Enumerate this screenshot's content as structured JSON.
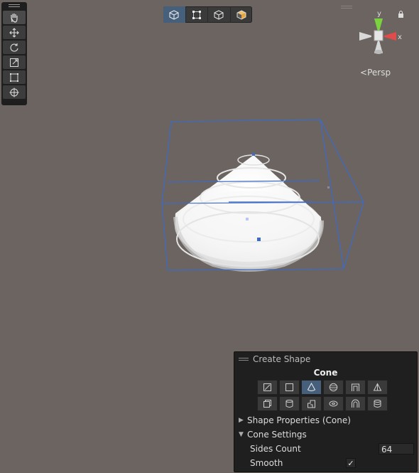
{
  "toolbar": {
    "tools": [
      {
        "icon": "hand-icon"
      },
      {
        "icon": "move-icon"
      },
      {
        "icon": "rotate-icon"
      },
      {
        "icon": "scale-icon"
      },
      {
        "icon": "rect-tool-icon"
      },
      {
        "icon": "transform-icon"
      }
    ]
  },
  "view_modes": [
    {
      "icon": "object-mode-icon",
      "active": true
    },
    {
      "icon": "vertex-mode-icon"
    },
    {
      "icon": "edge-mode-icon"
    },
    {
      "icon": "face-mode-icon"
    }
  ],
  "gizmo": {
    "y_label": "y",
    "x_label": "x",
    "projection": "Persp"
  },
  "panel": {
    "title": "Create Shape",
    "shape_name": "Cone",
    "shapes": [
      "plane",
      "cube",
      "cone",
      "sphere",
      "door",
      "prism",
      "stair",
      "cylinder",
      "arch",
      "torus",
      "pipe",
      "drum"
    ],
    "active_shape": "cone",
    "shape_properties_label": "Shape Properties (Cone)",
    "cone_settings_label": "Cone Settings",
    "sides_count_label": "Sides Count",
    "sides_count_value": "64",
    "smooth_label": "Smooth",
    "smooth_checked": "✓"
  },
  "colors": {
    "viewport": "#6b6460",
    "selection": "#3d6bc7",
    "gizmo_y": "#7bd23f",
    "gizmo_x": "#e04b4b",
    "active_button": "#46607c"
  }
}
